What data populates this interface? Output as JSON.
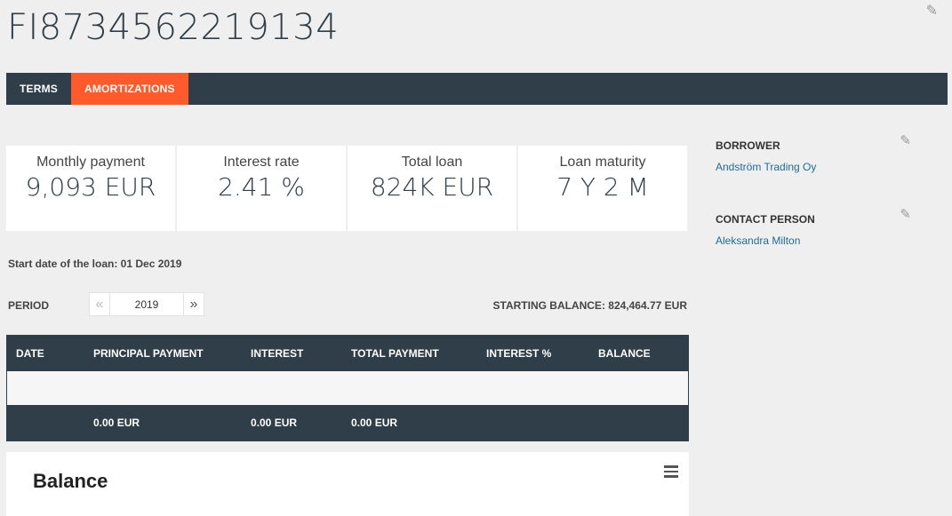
{
  "header": {
    "title": "FI8734562219134",
    "edit_icon": "pencil-icon"
  },
  "tabs": [
    {
      "label": "TERMS",
      "active": false
    },
    {
      "label": "AMORTIZATIONS",
      "active": true
    }
  ],
  "stats": [
    {
      "label": "Monthly payment",
      "value": "9,093 EUR"
    },
    {
      "label": "Interest rate",
      "value": "2.41 %"
    },
    {
      "label": "Total loan",
      "value": "824K EUR"
    },
    {
      "label": "Loan maturity",
      "value": "7 Y 2 M"
    }
  ],
  "start_date": "Start date of the loan: 01 Dec 2019",
  "period": {
    "label": "PERIOD",
    "year": "2019",
    "prev_icon": "double-chevron-left-icon",
    "next_icon": "double-chevron-right-icon",
    "starting_balance": "STARTING BALANCE: 824,464.77 EUR"
  },
  "table": {
    "headers": [
      "DATE",
      "PRINCIPAL PAYMENT",
      "INTEREST",
      "TOTAL PAYMENT",
      "INTEREST %",
      "BALANCE"
    ],
    "totals": [
      "",
      "0.00 EUR",
      "0.00 EUR",
      "0.00 EUR",
      "",
      ""
    ]
  },
  "balance_card": {
    "title": "Balance",
    "menu_icon": "hamburger-menu-icon"
  },
  "sidebar": {
    "borrower": {
      "heading": "BORROWER",
      "name": "Andström Trading Oy"
    },
    "contact": {
      "heading": "CONTACT PERSON",
      "name": "Aleksandra Milton"
    }
  },
  "colors": {
    "dark": "#2f3e48",
    "accent": "#ff5a2b",
    "link": "#1f6c9a",
    "bg": "#efefef"
  }
}
